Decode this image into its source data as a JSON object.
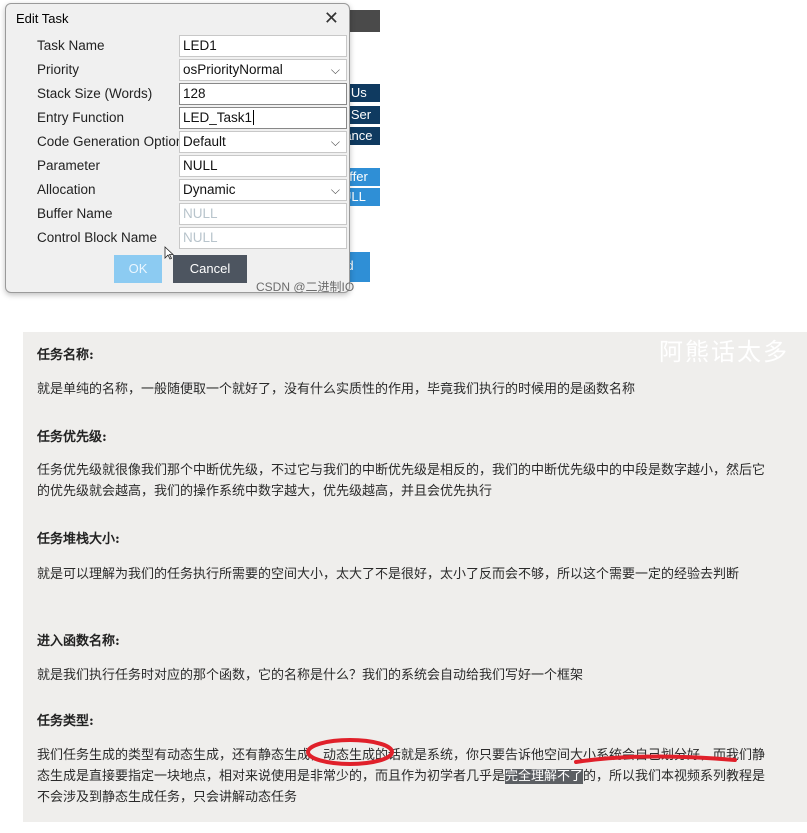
{
  "dialog": {
    "title": "Edit Task",
    "close_glyph": "✕",
    "fields": [
      {
        "label": "Task Name",
        "value": "LED1",
        "kind": "text"
      },
      {
        "label": "Priority",
        "value": "osPriorityNormal",
        "kind": "select"
      },
      {
        "label": "Stack Size (Words)",
        "value": "128",
        "kind": "text"
      },
      {
        "label": "Entry Function",
        "value": "LED_Task1",
        "kind": "text"
      },
      {
        "label": "Code Generation Option",
        "value": "Default",
        "kind": "select"
      },
      {
        "label": "Parameter",
        "value": "NULL",
        "kind": "text"
      },
      {
        "label": "Allocation",
        "value": "Dynamic",
        "kind": "select"
      },
      {
        "label": "Buffer Name",
        "value": "NULL",
        "kind": "disabled"
      },
      {
        "label": "Control Block Name",
        "value": "NULL",
        "kind": "disabled"
      }
    ],
    "ok_label": "OK",
    "cancel_label": "Cancel"
  },
  "background_fragments": [
    "p Us",
    "d Ser",
    "rance",
    "uffer",
    "ULL",
    "d"
  ],
  "watermark_top": "CSDN @二进制IO",
  "watermark_article": "阿熊话太多",
  "article": {
    "sections": [
      {
        "heading": "任务名称:",
        "body": "就是单纯的名称，一般随便取一个就好了，没有什么实质性的作用，毕竟我们执行的时候用的是函数名称"
      },
      {
        "heading": "任务优先级:",
        "body": "任务优先级就很像我们那个中断优先级，不过它与我们的中断优先级是相反的，我们的中断优先级中的中段是数字越小，然后它的优先级就会越高，我们的操作系统中数字越大，优先级越高，并且会优先执行"
      },
      {
        "heading": "任务堆栈大小:",
        "body": "就是可以理解为我们的任务执行所需要的空间大小，太大了不是很好，太小了反而会不够，所以这个需要一定的经验去判断"
      },
      {
        "heading": "进入函数名称:",
        "body": "就是我们执行任务时对应的那个函数，它的名称是什么？我们的系统会自动给我们写好一个框架"
      },
      {
        "heading": "任务类型:",
        "body_before": "我们任务生成的类型有动态生成，还有静态生成，动态生成的话就是系统，你只要告诉他空间大小系统会自己划分好，而我们静态生成是直接要指定一块地点，相对来说使用是非常少的，而且作为初学者几乎是",
        "highlight": "完全理解不了",
        "body_after": "的，所以我们本视频系列教程是不会涉及到静态生成任务，只会讲解动态任务"
      }
    ]
  },
  "colors": {
    "dialog_bg": "#f0f0f0",
    "ok_button": "#8ccbf2",
    "cancel_button": "#4d5560",
    "annotation_red": "#e0202a",
    "article_bg": "#efeeec"
  }
}
